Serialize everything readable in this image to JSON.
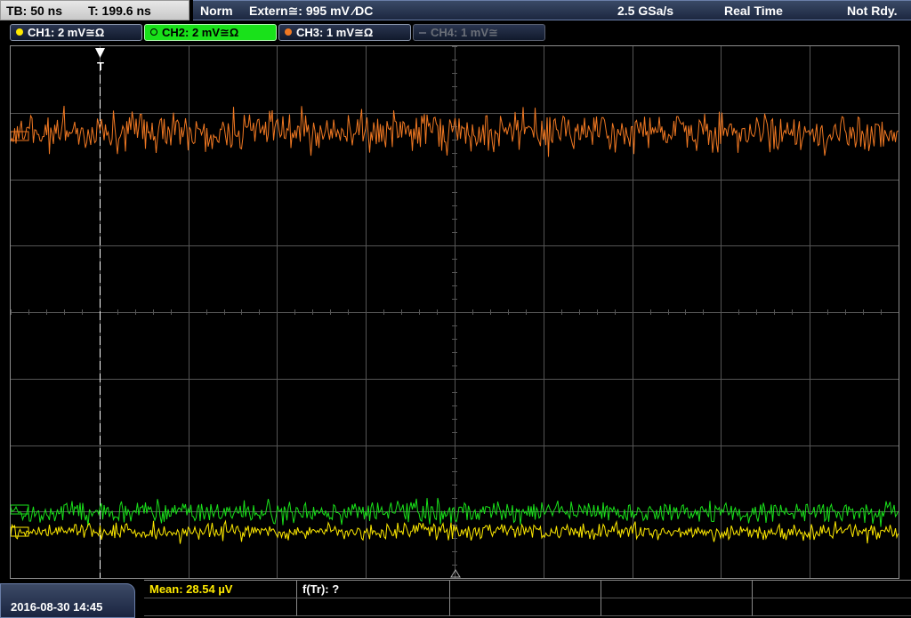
{
  "status": {
    "timebase": "TB: 50 ns",
    "trigger_time": "T: 199.6 ns",
    "trigger_mode": "Norm",
    "trigger_source": "Extern≅: 995 mV ⁄DC",
    "sample_rate": "2.5 GSa/s",
    "acq_mode": "Real Time",
    "state": "Not Rdy."
  },
  "channels": [
    {
      "label": "CH1: 2 mV≅Ω",
      "color": "#ffea00",
      "active": false,
      "enabled": true
    },
    {
      "label": "CH2: 2 mV≅Ω",
      "color": "#19e11a",
      "active": true,
      "enabled": true
    },
    {
      "label": "CH3: 1 mV≅Ω",
      "color": "#f07822",
      "active": false,
      "enabled": true
    },
    {
      "label": "CH4: 1 mV≅",
      "color": "#6a6f78",
      "active": false,
      "enabled": false
    }
  ],
  "trigger_marker": "T",
  "datetime": "2016-08-30 14:45",
  "measurements": {
    "mean": "Mean: 28.54 µV",
    "f_tr": "f(Tr): ?"
  },
  "colors": {
    "ch1": "#ffea00",
    "ch2": "#19e11a",
    "ch3": "#f07822",
    "grid": "#555555"
  }
}
